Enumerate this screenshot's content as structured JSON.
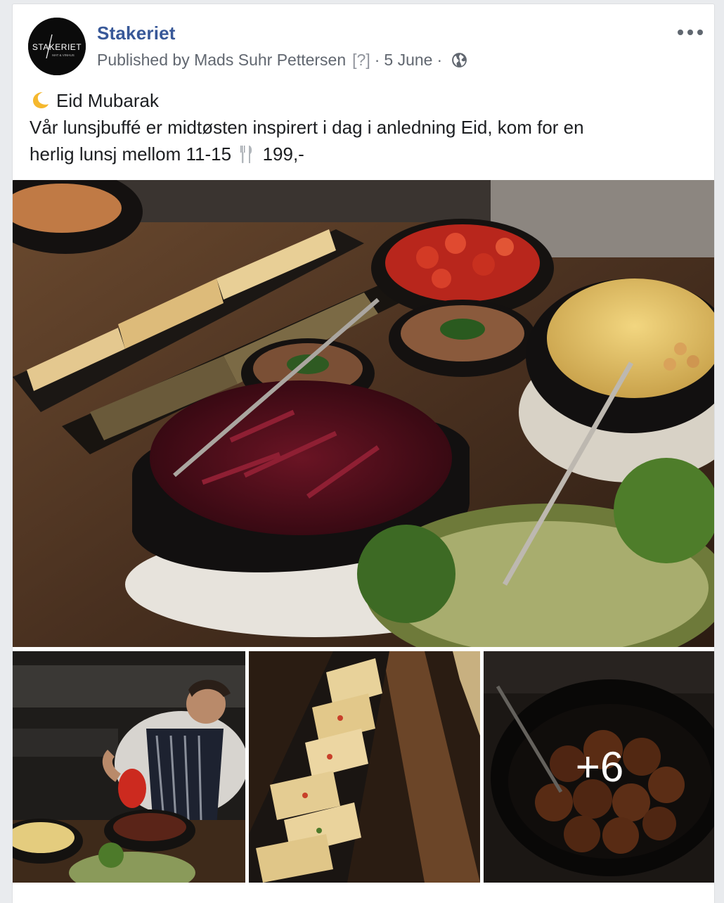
{
  "post": {
    "page_name": "Stakeriet",
    "avatar_logo_text": "STAKERIET",
    "avatar_logo_subtext": "MAT & VINHUS",
    "published_by": "Published by Mads Suhr Pettersen",
    "help_marker": "[?]",
    "separator": "·",
    "date": "5 June",
    "privacy_icon": "globe-icon",
    "more_icon": "more-options-icon",
    "text_line1": "Eid Mubarak",
    "text_line2": "Vår lunsjbuffé er midtøsten inspirert i dag i anledning Eid, kom for en",
    "text_line3_a": "herlig lunsj mellom 11-15",
    "text_line3_b": "199,-",
    "emoji_1": "crescent-moon-icon",
    "emoji_2": "fork-knife-icon"
  },
  "photos": {
    "main": "buffet-table-photo",
    "thumbs": [
      "chef-photo",
      "frittata-photo",
      "falafel-photo"
    ],
    "more_count": "+6"
  },
  "colors": {
    "link_blue": "#385898",
    "meta_gray": "#616770",
    "text": "#1c1e21",
    "background": "#e9ebee"
  }
}
